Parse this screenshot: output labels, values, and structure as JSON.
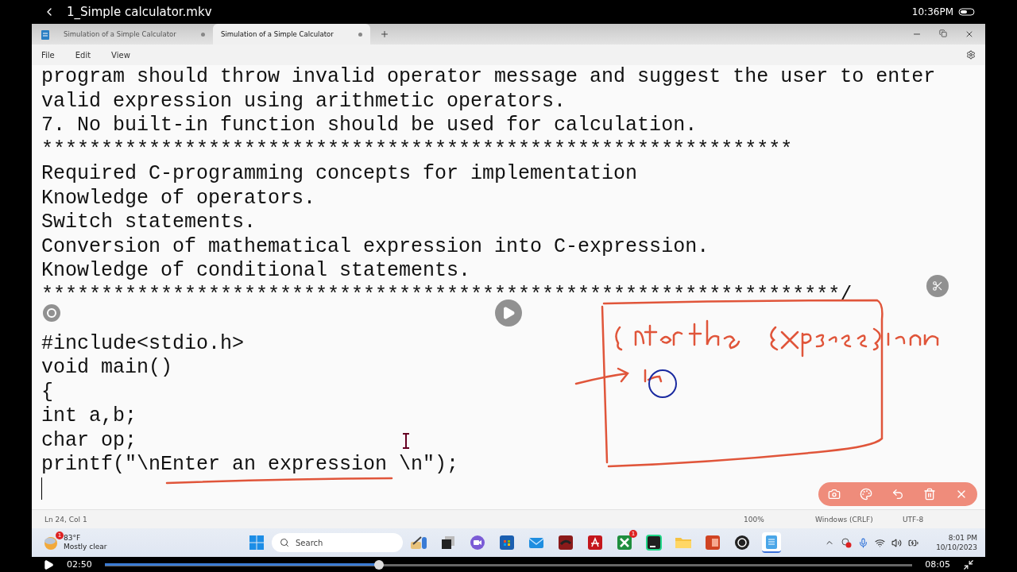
{
  "video": {
    "title": "1_Simple calculator.mkv",
    "clock": "10:36PM",
    "elapsed": "02:50",
    "duration": "08:05",
    "level": 0.34
  },
  "notepad": {
    "tabs": [
      {
        "label": "Simulation of a Simple Calculator",
        "selected": false
      },
      {
        "label": "Simulation of a Simple Calculator",
        "selected": true
      }
    ],
    "menu": [
      "File",
      "Edit",
      "View"
    ],
    "lines": [
      {
        "kind": "text",
        "text": "program should throw invalid operator message and suggest the user to enter"
      },
      {
        "kind": "text",
        "text": "valid expression using arithmetic operators."
      },
      {
        "kind": "text",
        "text": "7. No built-in function should be used for calculation."
      },
      {
        "kind": "text",
        "text": "***************************************************************"
      },
      {
        "kind": "text",
        "text": "Required C-programming concepts for implementation"
      },
      {
        "kind": "text",
        "text": "Knowledge of operators."
      },
      {
        "kind": "text",
        "text": "Switch statements."
      },
      {
        "kind": "text",
        "text": "Conversion of mathematical expression into C-expression."
      },
      {
        "kind": "text",
        "text": "Knowledge of conditional statements."
      },
      {
        "kind": "text",
        "text": "*******************************************************************/"
      },
      {
        "kind": "blank"
      },
      {
        "kind": "text",
        "text": "#include<stdio.h>"
      },
      {
        "kind": "text",
        "text": "void main()"
      },
      {
        "kind": "text",
        "text": "{"
      },
      {
        "kind": "text",
        "text": "int a,b;"
      },
      {
        "kind": "text",
        "text": "char op;"
      },
      {
        "kind": "text",
        "text": "printf(\"\\nEnter an expression \\n\");"
      },
      {
        "kind": "cursor"
      }
    ],
    "status": {
      "position": "Ln 24, Col 1",
      "zoom": "100%",
      "line_ending": "Windows (CRLF)",
      "encoding": "UTF-8"
    }
  },
  "taskbar": {
    "weather": {
      "badge": "1",
      "temperature": "83°F",
      "condition": "Mostly clear"
    },
    "search": {
      "placeholder": "Search"
    },
    "apps": [
      {
        "kind": "copilot"
      },
      {
        "kind": "taskview"
      },
      {
        "kind": "chat"
      },
      {
        "kind": "store"
      },
      {
        "kind": "mail"
      },
      {
        "kind": "redapp"
      },
      {
        "kind": "pdf"
      },
      {
        "kind": "xbox",
        "badge": "1"
      },
      {
        "kind": "ide"
      },
      {
        "kind": "folder"
      },
      {
        "kind": "slides"
      },
      {
        "kind": "recorder"
      },
      {
        "kind": "notepad",
        "selected": true
      }
    ],
    "time": "8:01 PM",
    "date": "10/10/2023"
  }
}
